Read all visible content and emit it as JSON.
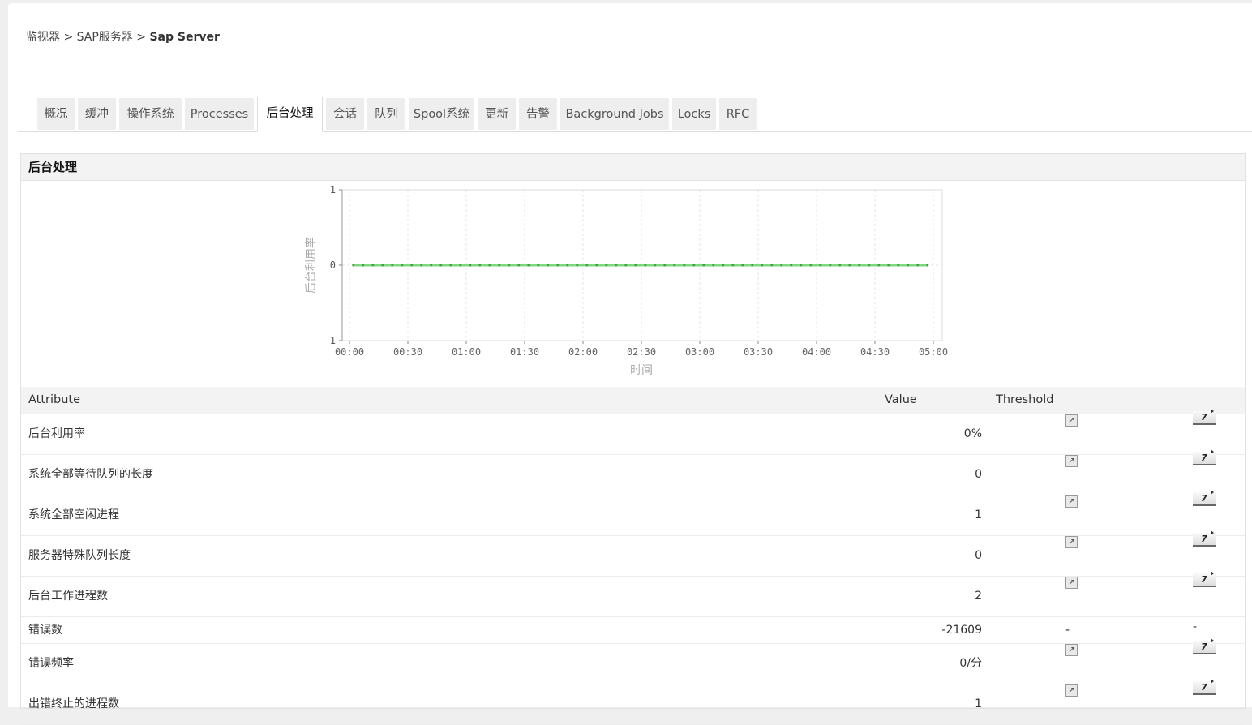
{
  "breadcrumb": {
    "items": [
      "监视器",
      "SAP服务器"
    ],
    "current": "Sap Server",
    "separator": ">"
  },
  "tabs": [
    "概况",
    "缓冲",
    "操作系统",
    "Processes",
    "后台处理",
    "会话",
    "队列",
    "Spool系统",
    "更新",
    "告警",
    "Background Jobs",
    "Locks",
    "RFC"
  ],
  "active_tab": 4,
  "panel": {
    "title": "后台处理"
  },
  "chart_data": {
    "type": "line",
    "title": "",
    "xlabel": "时间",
    "ylabel": "后台利用率",
    "ylim": [
      -1,
      1
    ],
    "yticks": [
      "-1",
      "0",
      "1"
    ],
    "xticks": [
      "00:00",
      "00:30",
      "01:00",
      "01:30",
      "02:00",
      "02:30",
      "03:00",
      "03:30",
      "04:00",
      "04:30",
      "05:00"
    ],
    "x_start_minutes": 2,
    "x_interval_minutes": 5,
    "series": [
      {
        "name": "后台利用率",
        "color": "#4fc94f",
        "values": [
          0,
          0,
          0,
          0,
          0,
          0,
          0,
          0,
          0,
          0,
          0,
          0,
          0,
          0,
          0,
          0,
          0,
          0,
          0,
          0,
          0,
          0,
          0,
          0,
          0,
          0,
          0,
          0,
          0,
          0,
          0,
          0,
          0,
          0,
          0,
          0,
          0,
          0,
          0,
          0,
          0,
          0,
          0,
          0,
          0,
          0,
          0,
          0,
          0,
          0,
          0,
          0,
          0,
          0,
          0,
          0,
          0,
          0,
          0,
          0
        ]
      }
    ],
    "grid": true
  },
  "table": {
    "headers": [
      "Attribute",
      "Value",
      "Threshold"
    ],
    "rows": [
      {
        "attr": "后台利用率",
        "value": "0%",
        "threshold": "icon",
        "report": "7"
      },
      {
        "attr": "系统全部等待队列的长度",
        "value": "0",
        "threshold": "icon",
        "report": "7"
      },
      {
        "attr": "系统全部空闲进程",
        "value": "1",
        "threshold": "icon",
        "report": "7"
      },
      {
        "attr": "服务器特殊队列长度",
        "value": "0",
        "threshold": "icon",
        "report": "7"
      },
      {
        "attr": "后台工作进程数",
        "value": "2",
        "threshold": "icon",
        "report": "7"
      },
      {
        "attr": "错误数",
        "value": "-21609",
        "threshold": "-",
        "report": "-"
      },
      {
        "attr": "错误频率",
        "value": "0/分",
        "threshold": "icon",
        "report": "7"
      },
      {
        "attr": "出错终止的进程数",
        "value": "1",
        "threshold": "icon",
        "report": "7"
      }
    ]
  },
  "icons": {
    "threshold": "edit-threshold-icon",
    "report": "report-7day-icon"
  }
}
